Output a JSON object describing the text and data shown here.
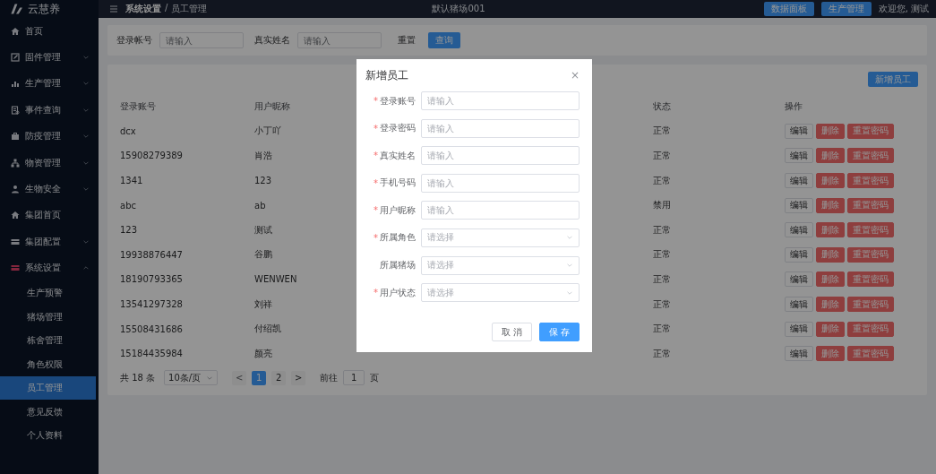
{
  "topbar": {
    "logo_text": "云慧养",
    "breadcrumb": [
      {
        "label": "系统设置"
      },
      {
        "label": "员工管理"
      }
    ],
    "breadcrumb_separator": "/",
    "farm": "默认猪场001",
    "buttons": [
      {
        "label": "数据面板"
      },
      {
        "label": "生产管理"
      }
    ],
    "user": "欢迎您, 测试"
  },
  "sidebar": {
    "items": [
      {
        "label": "首页",
        "expandable": false,
        "expanded": false
      },
      {
        "label": "固件管理",
        "expandable": true,
        "expanded": false
      },
      {
        "label": "生产管理",
        "expandable": true,
        "expanded": false
      },
      {
        "label": "事件查询",
        "expandable": true,
        "expanded": false
      },
      {
        "label": "防疫管理",
        "expandable": true,
        "expanded": false
      },
      {
        "label": "物资管理",
        "expandable": true,
        "expanded": false
      },
      {
        "label": "生物安全",
        "expandable": true,
        "expanded": false
      },
      {
        "label": "集团首页",
        "expandable": false,
        "expanded": false
      },
      {
        "label": "集团配置",
        "expandable": true,
        "expanded": false
      },
      {
        "label": "系统设置",
        "expandable": true,
        "expanded": true,
        "children": [
          {
            "label": "生产预警",
            "selected": false
          },
          {
            "label": "猪场管理",
            "selected": false
          },
          {
            "label": "栋舍管理",
            "selected": false
          },
          {
            "label": "角色权限",
            "selected": false
          },
          {
            "label": "员工管理",
            "selected": true
          },
          {
            "label": "意见反馈",
            "selected": false
          },
          {
            "label": "个人资料",
            "selected": false
          }
        ]
      }
    ]
  },
  "search": {
    "fields": [
      {
        "label": "登录帐号",
        "placeholder": "请输入"
      },
      {
        "label": "真实姓名",
        "placeholder": "请输入"
      }
    ],
    "reset": "重置",
    "query": "查询"
  },
  "table": {
    "add_button": "新增员工",
    "columns": [
      "登录账号",
      "用户昵称",
      "状态",
      "操作"
    ],
    "rows": [
      {
        "account": "dcx",
        "nickname": "小丁吖",
        "status": "正常",
        "actions": [
          {
            "label": "编辑",
            "kind": "plain"
          },
          {
            "label": "删除",
            "kind": "danger"
          },
          {
            "label": "重置密码",
            "kind": "danger"
          }
        ]
      },
      {
        "account": "15908279389",
        "nickname": "肖浩",
        "status": "正常",
        "actions": [
          {
            "label": "编辑",
            "kind": "plain"
          },
          {
            "label": "删除",
            "kind": "danger"
          },
          {
            "label": "重置密码",
            "kind": "danger"
          }
        ]
      },
      {
        "account": "1341",
        "nickname": "123",
        "status": "正常",
        "actions": [
          {
            "label": "编辑",
            "kind": "plain"
          },
          {
            "label": "删除",
            "kind": "danger"
          },
          {
            "label": "重置密码",
            "kind": "danger"
          }
        ]
      },
      {
        "account": "abc",
        "nickname": "ab",
        "status": "禁用",
        "actions": [
          {
            "label": "编辑",
            "kind": "plain"
          },
          {
            "label": "删除",
            "kind": "danger"
          },
          {
            "label": "重置密码",
            "kind": "danger"
          }
        ]
      },
      {
        "account": "123",
        "nickname": "测试",
        "status": "正常",
        "actions": [
          {
            "label": "编辑",
            "kind": "plain"
          },
          {
            "label": "删除",
            "kind": "danger"
          },
          {
            "label": "重置密码",
            "kind": "danger"
          }
        ]
      },
      {
        "account": "19938876447",
        "nickname": "谷鹏",
        "status": "正常",
        "actions": [
          {
            "label": "编辑",
            "kind": "plain"
          },
          {
            "label": "删除",
            "kind": "danger"
          },
          {
            "label": "重置密码",
            "kind": "danger"
          }
        ]
      },
      {
        "account": "18190793365",
        "nickname": "WENWEN",
        "status": "正常",
        "actions": [
          {
            "label": "编辑",
            "kind": "plain"
          },
          {
            "label": "删除",
            "kind": "danger"
          },
          {
            "label": "重置密码",
            "kind": "danger"
          }
        ]
      },
      {
        "account": "13541297328",
        "nickname": "刘祥",
        "status": "正常",
        "actions": [
          {
            "label": "编辑",
            "kind": "plain"
          },
          {
            "label": "删除",
            "kind": "danger"
          },
          {
            "label": "重置密码",
            "kind": "danger"
          }
        ]
      },
      {
        "account": "15508431686",
        "nickname": "付绍凯",
        "status": "正常",
        "actions": [
          {
            "label": "编辑",
            "kind": "plain"
          },
          {
            "label": "删除",
            "kind": "danger"
          },
          {
            "label": "重置密码",
            "kind": "danger"
          }
        ]
      },
      {
        "account": "15184435984",
        "nickname": "颜亮",
        "status": "正常",
        "actions": [
          {
            "label": "编辑",
            "kind": "plain"
          },
          {
            "label": "删除",
            "kind": "danger"
          },
          {
            "label": "重置密码",
            "kind": "danger"
          }
        ]
      }
    ]
  },
  "pagination": {
    "total": "共 18 条",
    "page_size": "10条/页",
    "prev": "<",
    "pages": [
      {
        "label": "1",
        "selected": true
      },
      {
        "label": "2",
        "selected": false
      }
    ],
    "next": ">",
    "goto_label": "前往",
    "goto_value": "1",
    "goto_suffix": "页"
  },
  "dialog": {
    "title": "新增员工",
    "close": "×",
    "fields": [
      {
        "label": "登录账号",
        "required_mark": "*",
        "kind": "input",
        "placeholder": "请输入"
      },
      {
        "label": "登录密码",
        "required_mark": "*",
        "kind": "input",
        "placeholder": "请输入"
      },
      {
        "label": "真实姓名",
        "required_mark": "*",
        "kind": "input",
        "placeholder": "请输入"
      },
      {
        "label": "手机号码",
        "required_mark": "*",
        "kind": "input",
        "placeholder": "请输入"
      },
      {
        "label": "用户昵称",
        "required_mark": "*",
        "kind": "input",
        "placeholder": "请输入"
      },
      {
        "label": "所属角色",
        "required_mark": "*",
        "kind": "select",
        "placeholder": "请选择"
      },
      {
        "label": "所属猪场",
        "kind": "select",
        "placeholder": "请选择"
      },
      {
        "label": "用户状态",
        "required_mark": "*",
        "kind": "select",
        "placeholder": "请选择"
      }
    ],
    "cancel": "取 消",
    "save": "保 存"
  }
}
